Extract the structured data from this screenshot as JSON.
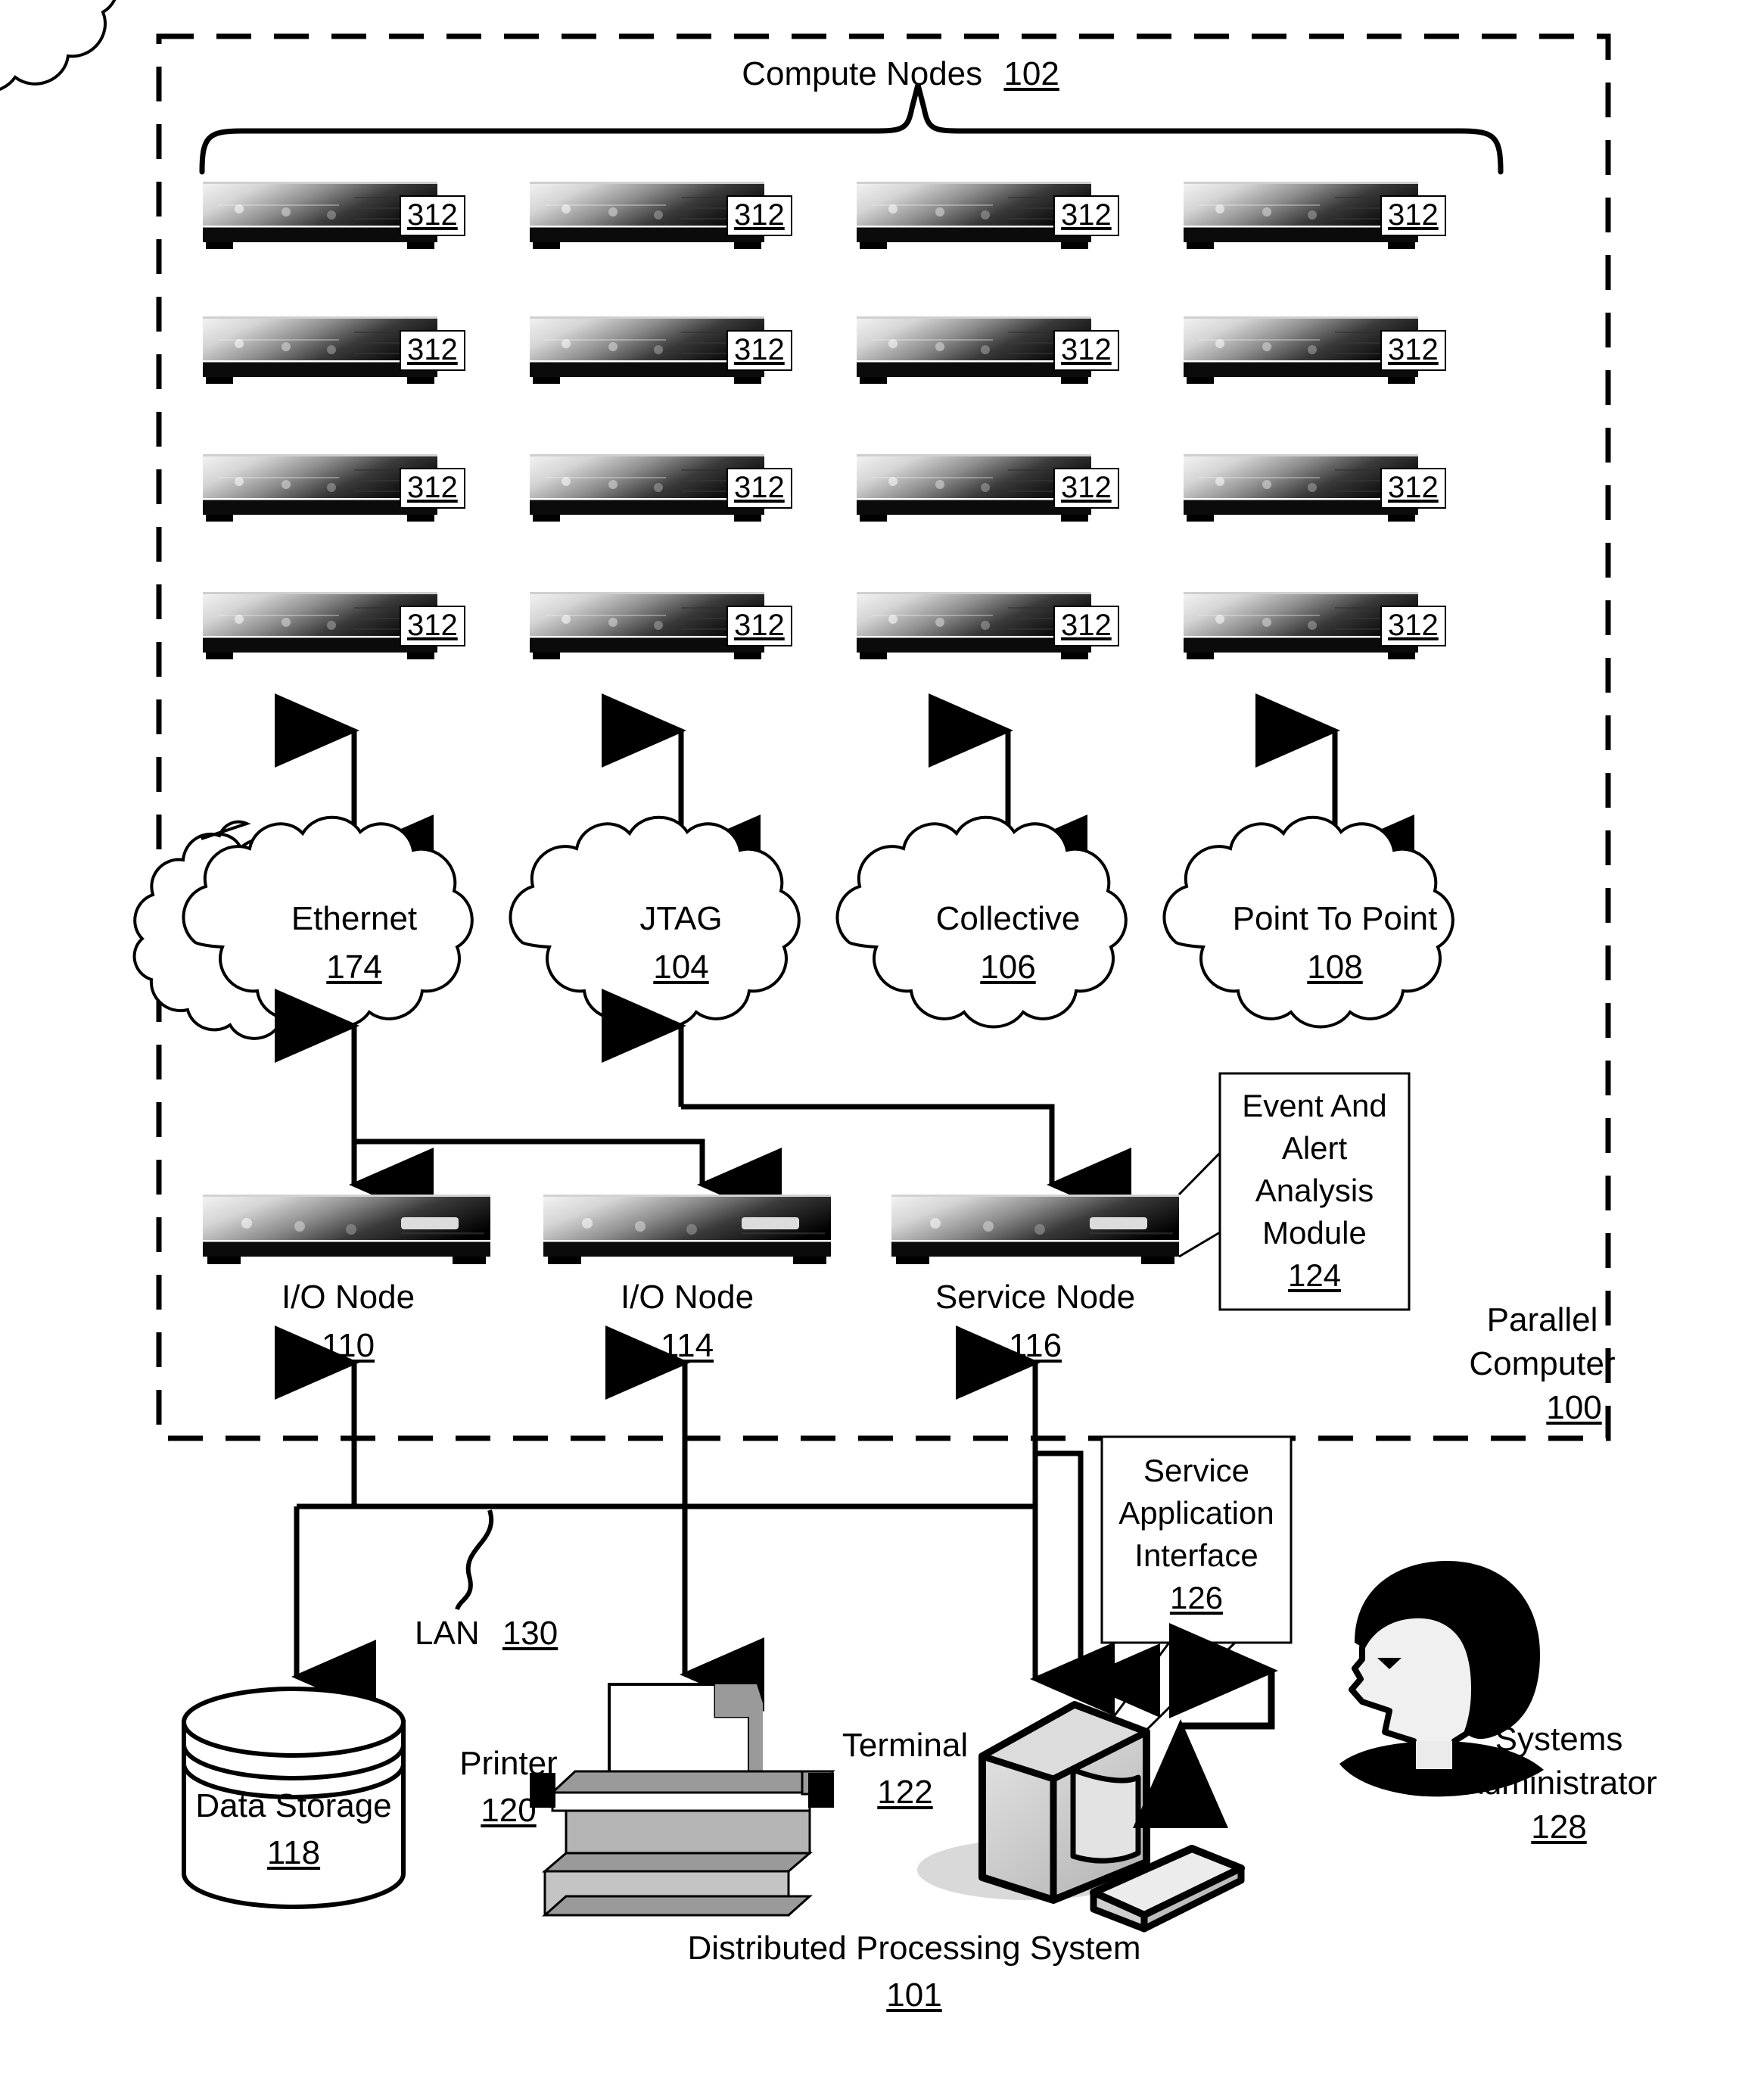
{
  "figure": {
    "compute_nodes_label": "Compute Nodes",
    "compute_nodes_ref": "102",
    "parallel_computer_label_line1": "Parallel",
    "parallel_computer_label_line2": "Computer",
    "parallel_computer_ref": "100",
    "distributed_system_label": "Distributed Processing System",
    "distributed_system_ref": "101",
    "lan_label": "LAN",
    "lan_ref": "130"
  },
  "compute_nodes": {
    "ref": "312",
    "rows": 4,
    "cols": 4,
    "items": [
      {
        "ref": "312"
      },
      {
        "ref": "312"
      },
      {
        "ref": "312"
      },
      {
        "ref": "312"
      },
      {
        "ref": "312"
      },
      {
        "ref": "312"
      },
      {
        "ref": "312"
      },
      {
        "ref": "312"
      },
      {
        "ref": "312"
      },
      {
        "ref": "312"
      },
      {
        "ref": "312"
      },
      {
        "ref": "312"
      },
      {
        "ref": "312"
      },
      {
        "ref": "312"
      },
      {
        "ref": "312"
      },
      {
        "ref": "312"
      }
    ]
  },
  "networks": [
    {
      "label": "Ethernet",
      "ref": "174"
    },
    {
      "label": "JTAG",
      "ref": "104"
    },
    {
      "label": "Collective",
      "ref": "106"
    },
    {
      "label": "Point To Point",
      "ref": "108"
    }
  ],
  "nodes": [
    {
      "label": "I/O Node",
      "ref": "110"
    },
    {
      "label": "I/O Node",
      "ref": "114"
    },
    {
      "label": "Service Node",
      "ref": "116"
    }
  ],
  "callouts": {
    "event_alert": {
      "line1": "Event And",
      "line2": "Alert",
      "line3": "Analysis",
      "line4": "Module",
      "ref": "124"
    },
    "service_app": {
      "line1": "Service",
      "line2": "Application",
      "line3": "Interface",
      "ref": "126"
    }
  },
  "peripherals": {
    "data_storage": {
      "label": "Data Storage",
      "ref": "118"
    },
    "printer": {
      "label": "Printer",
      "ref": "120"
    },
    "terminal": {
      "label": "Terminal",
      "ref": "122"
    },
    "admin": {
      "line1": "Systems",
      "line2": "Administrator",
      "ref": "128"
    }
  },
  "colors": {
    "stroke": "#000000",
    "background": "#ffffff",
    "node_light": "#f2f2f2",
    "node_dark": "#050505",
    "gray_body": "#9a9a9a",
    "gray_mid": "#c4c4c4"
  }
}
